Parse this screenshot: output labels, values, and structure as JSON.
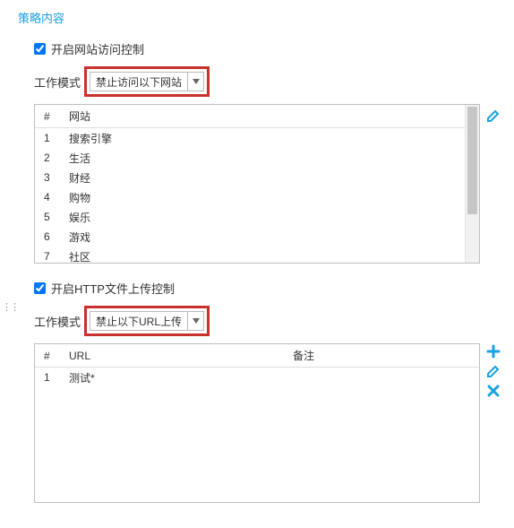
{
  "section_title": "策略内容",
  "web": {
    "checkbox_label": "开启网站访问控制",
    "checked": true,
    "mode_label": "工作模式",
    "mode_value": "禁止访问以下网站",
    "columns": {
      "idx": "#",
      "site": "网站"
    },
    "rows": [
      {
        "idx": "1",
        "site": "搜索引擎"
      },
      {
        "idx": "2",
        "site": "生活"
      },
      {
        "idx": "3",
        "site": "财经"
      },
      {
        "idx": "4",
        "site": "购物"
      },
      {
        "idx": "5",
        "site": "娱乐"
      },
      {
        "idx": "6",
        "site": "游戏"
      },
      {
        "idx": "7",
        "site": "社区"
      }
    ]
  },
  "http": {
    "checkbox_label": "开启HTTP文件上传控制",
    "checked": true,
    "mode_label": "工作模式",
    "mode_value": "禁止以下URL上传",
    "columns": {
      "idx": "#",
      "url": "URL",
      "remark": "备注"
    },
    "rows": [
      {
        "idx": "1",
        "url": "测试*",
        "remark": ""
      }
    ]
  }
}
